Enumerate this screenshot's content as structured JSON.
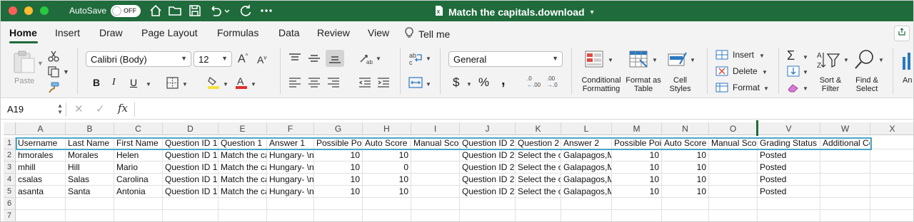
{
  "window": {
    "autosave_label": "AutoSave",
    "autosave_state": "OFF",
    "doc_title": "Match the capitals.download",
    "title_color": "#1f6b3c"
  },
  "menu": {
    "tabs": [
      "Home",
      "Insert",
      "Draw",
      "Page Layout",
      "Formulas",
      "Data",
      "Review",
      "View"
    ],
    "tell_me": "Tell me"
  },
  "ribbon": {
    "paste": "Paste",
    "font_name": "Calibri (Body)",
    "font_size": "12",
    "bold": "B",
    "italic": "I",
    "underline": "U",
    "number_format": "General",
    "conditional_formatting": "Conditional Formatting",
    "format_as_table": "Format as Table",
    "cell_styles": "Cell Styles",
    "insert": "Insert",
    "delete": "Delete",
    "format": "Format",
    "sort_filter": "Sort & Filter",
    "find_select": "Find & Select",
    "analyze_partial": "An",
    "dollar": "$",
    "percent": "%",
    "comma": ",",
    "dec_increase": ".00",
    "dec_decrease": ".0"
  },
  "formula_bar": {
    "name_box": "A19",
    "fx": "fx",
    "value": ""
  },
  "grid": {
    "columns": [
      "A",
      "B",
      "C",
      "D",
      "E",
      "F",
      "G",
      "H",
      "I",
      "J",
      "K",
      "L",
      "M",
      "N",
      "O",
      "V",
      "W",
      "X"
    ],
    "row_numbers": [
      "1",
      "2",
      "3",
      "4",
      "5",
      "6",
      "7"
    ],
    "rows": [
      [
        "Username",
        "Last Name",
        "First Name",
        "Question ID 1",
        "Question 1",
        "Answer 1",
        "Possible Poir",
        "Auto Score 1",
        "Manual Scor",
        "Question ID 2",
        "Question 2",
        "Answer 2",
        "Possible Poir",
        "Auto Score 2",
        "Manual Scor",
        "Grading Status",
        "Additional Content",
        ""
      ],
      [
        "hmorales",
        "Morales",
        "Helen",
        "Question ID 1",
        "Match the ca",
        "Hungary- \\np",
        "10",
        "10",
        "",
        "Question ID 2",
        "Select the op",
        "Galapagos,M",
        "10",
        "10",
        "",
        "Posted",
        "",
        ""
      ],
      [
        "mhill",
        "Hill",
        "Mario",
        "Question ID 1",
        "Match the ca",
        "Hungary- \\nh",
        "10",
        "0",
        "",
        "Question ID 2",
        "Select the op",
        "Galapagos,M",
        "10",
        "10",
        "",
        "Posted",
        "",
        ""
      ],
      [
        "csalas",
        "Salas",
        "Carolina",
        "Question ID 1",
        "Match the ca",
        "Hungary- \\np",
        "10",
        "10",
        "",
        "Question ID 2",
        "Select the op",
        "Galapagos,M",
        "10",
        "10",
        "",
        "Posted",
        "",
        ""
      ],
      [
        "asanta",
        "Santa",
        "Antonia",
        "Question ID 1",
        "Match the ca",
        "Hungary- \\np",
        "10",
        "10",
        "",
        "Question ID 2",
        "Select the op",
        "Galapagos,M",
        "10",
        "10",
        "",
        "Posted",
        "",
        ""
      ],
      [
        "",
        "",
        "",
        "",
        "",
        "",
        "",
        "",
        "",
        "",
        "",
        "",
        "",
        "",
        "",
        "",
        "",
        ""
      ],
      [
        "",
        "",
        "",
        "",
        "",
        "",
        "",
        "",
        "",
        "",
        "",
        "",
        "",
        "",
        "",
        "",
        "",
        ""
      ]
    ]
  }
}
